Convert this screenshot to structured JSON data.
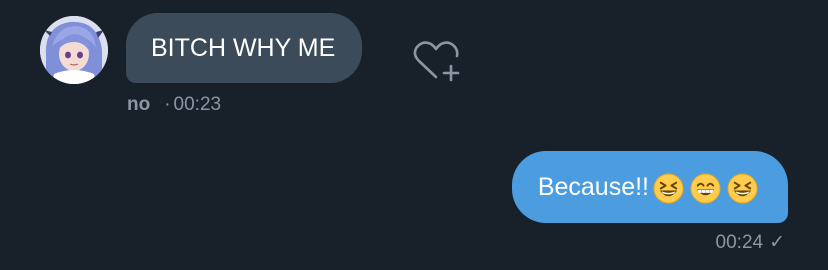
{
  "incoming": {
    "avatar": "avatar",
    "text": "BITCH WHY ME",
    "sender": "no",
    "separator": "·",
    "time": "00:23",
    "react_icon": "heart-plus-icon"
  },
  "outgoing": {
    "text": "Because!!",
    "emojis": [
      "grinning-squinting-face",
      "beaming-face",
      "grinning-squinting-face"
    ],
    "time": "00:24",
    "status_icon": "single-check-icon",
    "status_glyph": "✓"
  },
  "colors": {
    "background": "#18202a",
    "incoming_bubble": "#3c4b59",
    "outgoing_bubble": "#4b9de0",
    "meta_text": "#8c96a2"
  }
}
